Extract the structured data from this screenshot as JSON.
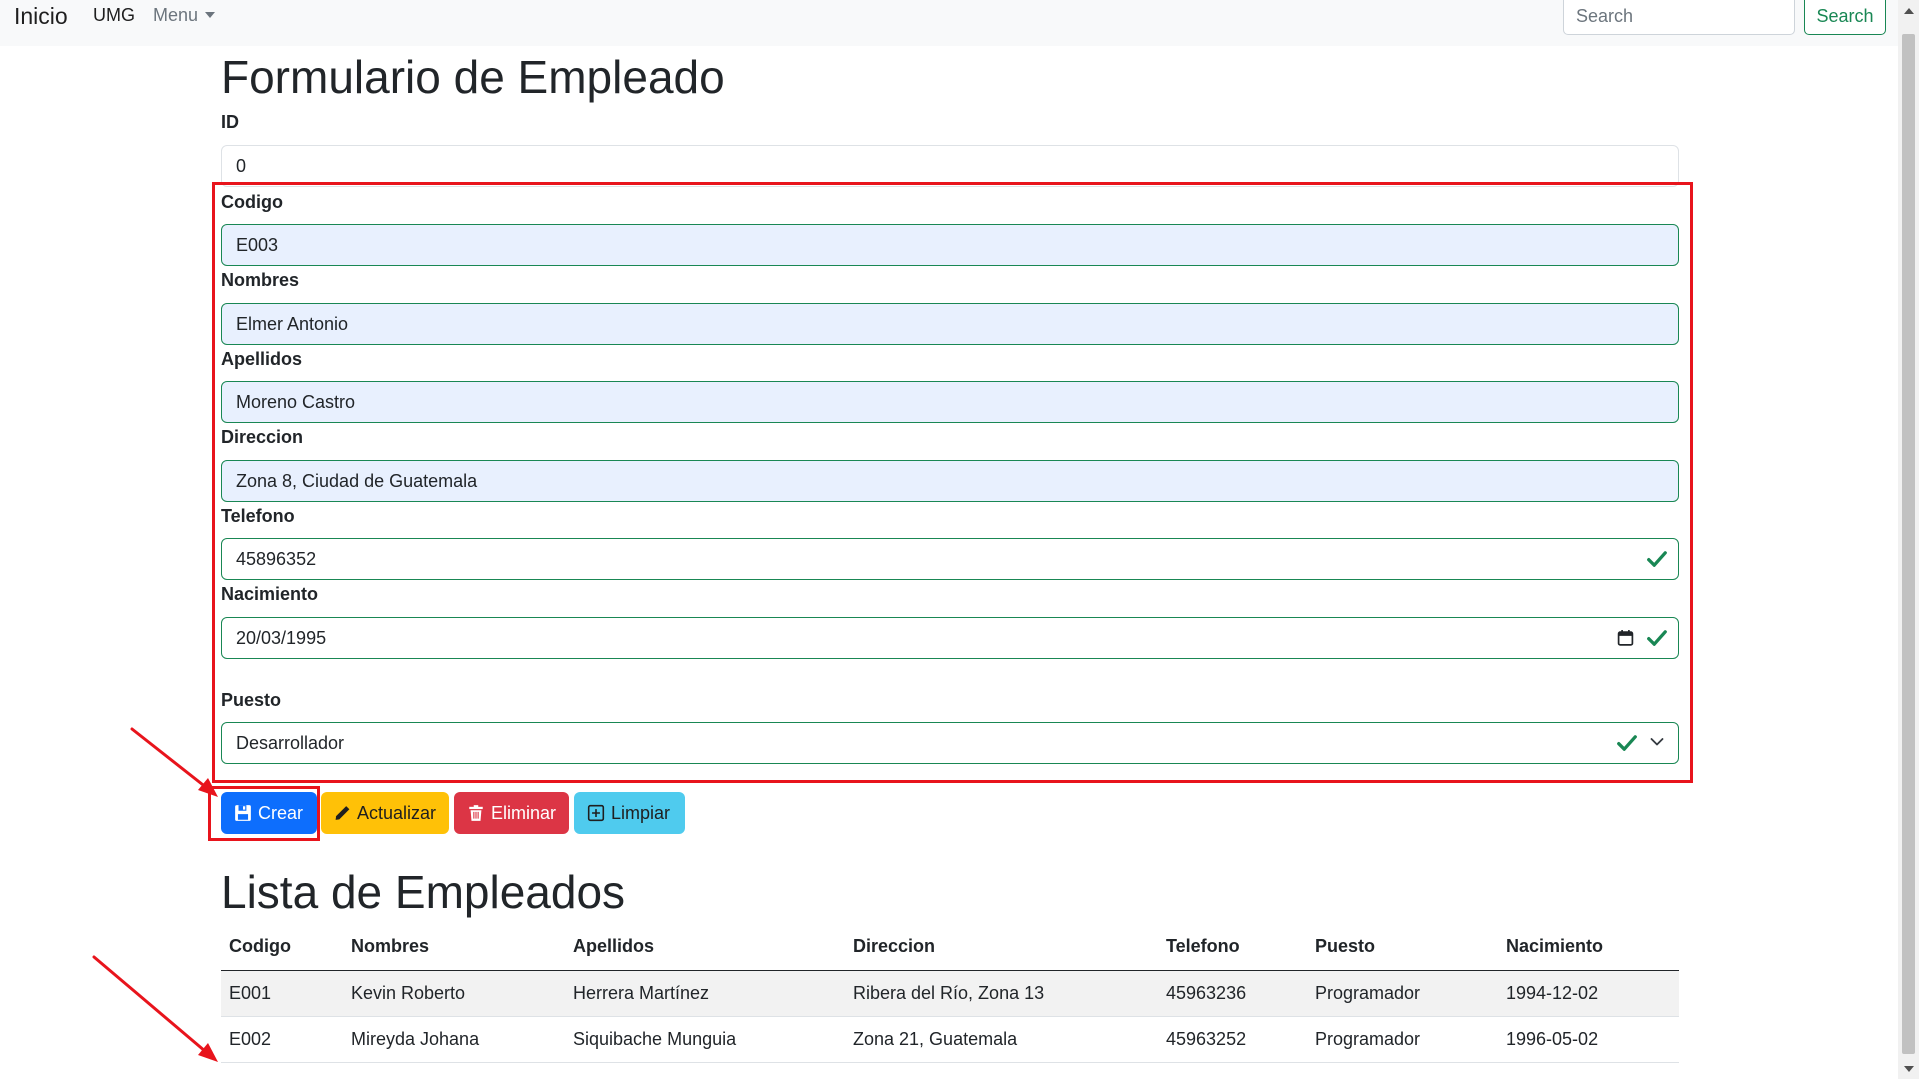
{
  "navbar": {
    "brand": "Inicio",
    "links": [
      "UMG",
      "Menu"
    ],
    "search_placeholder": "Search",
    "search_button": "Search"
  },
  "form": {
    "title": "Formulario de Empleado",
    "fields": [
      {
        "label": "ID",
        "value": "0"
      },
      {
        "label": "Codigo",
        "value": "E003"
      },
      {
        "label": "Nombres",
        "value": "Elmer Antonio"
      },
      {
        "label": "Apellidos",
        "value": "Moreno Castro"
      },
      {
        "label": "Direccion",
        "value": "Zona 8, Ciudad de Guatemala"
      },
      {
        "label": "Telefono",
        "value": "45896352"
      },
      {
        "label": "Nacimiento",
        "value": "20/03/1995"
      },
      {
        "label": "Puesto",
        "value": "Desarrollador"
      }
    ],
    "buttons": {
      "crear": "Crear",
      "actualizar": "Actualizar",
      "eliminar": "Eliminar",
      "limpiar": "Limpiar"
    }
  },
  "list": {
    "title": "Lista de Empleados",
    "columns": [
      "Codigo",
      "Nombres",
      "Apellidos",
      "Direccion",
      "Telefono",
      "Puesto",
      "Nacimiento"
    ],
    "rows": [
      [
        "E001",
        "Kevin Roberto",
        "Herrera Martínez",
        "Ribera del Río, Zona 13",
        "45963236",
        "Programador",
        "1994-12-02"
      ],
      [
        "E002",
        "Mireyda Johana",
        "Siquibache Munguia",
        "Zona 21, Guatemala",
        "45963252",
        "Programador",
        "1996-05-02"
      ]
    ]
  },
  "colors": {
    "primary": "#0d6efd",
    "warning": "#ffc107",
    "danger": "#dc3545",
    "info": "#4fcbee",
    "success": "#198754",
    "annotation": "#e8141c"
  },
  "icons": {
    "crear": "save-icon",
    "actualizar": "pencil-icon",
    "eliminar": "trash-icon",
    "limpiar": "plus-square-icon"
  }
}
